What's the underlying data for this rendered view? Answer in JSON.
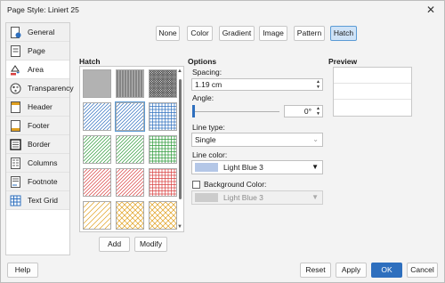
{
  "window": {
    "title": "Page Style: Liniert 25",
    "close_glyph": "✕"
  },
  "sidebar": {
    "items": [
      {
        "label": "General",
        "icon": "general-page-icon"
      },
      {
        "label": "Page",
        "icon": "page-icon"
      },
      {
        "label": "Area",
        "icon": "area-fill-icon",
        "active": true
      },
      {
        "label": "Transparency",
        "icon": "transparency-icon"
      },
      {
        "label": "Header",
        "icon": "header-icon"
      },
      {
        "label": "Footer",
        "icon": "footer-icon"
      },
      {
        "label": "Border",
        "icon": "border-icon"
      },
      {
        "label": "Columns",
        "icon": "columns-icon"
      },
      {
        "label": "Footnote",
        "icon": "footnote-icon"
      },
      {
        "label": "Text Grid",
        "icon": "text-grid-icon"
      }
    ]
  },
  "tabs": {
    "none": "None",
    "color": "Color",
    "gradient": "Gradient",
    "image": "Image",
    "pattern": "Pattern",
    "hatch": "Hatch",
    "active": "Hatch"
  },
  "hatch": {
    "title": "Hatch",
    "add_label": "Add",
    "modify_label": "Modify",
    "cells": [
      {
        "color": "#333333",
        "pattern": "horizontal-dense"
      },
      {
        "color": "#333333",
        "pattern": "cross-dense"
      },
      {
        "color": "#333333",
        "pattern": "cross-diag-dense"
      },
      {
        "color": "#2e6fbe",
        "pattern": "diagonal"
      },
      {
        "color": "#2e6fbe",
        "pattern": "diagonal-sel"
      },
      {
        "color": "#2e6fbe",
        "pattern": "cross"
      },
      {
        "color": "#2e9a3a",
        "pattern": "diagonal"
      },
      {
        "color": "#2e9a3a",
        "pattern": "diagonal"
      },
      {
        "color": "#2e9a3a",
        "pattern": "cross"
      },
      {
        "color": "#d94040",
        "pattern": "diagonal"
      },
      {
        "color": "#d94040",
        "pattern": "diagonal"
      },
      {
        "color": "#d94040",
        "pattern": "cross"
      },
      {
        "color": "#e0a020",
        "pattern": "diagonal-sparse"
      },
      {
        "color": "#e0a020",
        "pattern": "diamond"
      },
      {
        "color": "#e0a020",
        "pattern": "diamond"
      }
    ]
  },
  "options": {
    "title": "Options",
    "spacing_label": "Spacing:",
    "spacing_value": "1.19 cm",
    "angle_label": "Angle:",
    "angle_value": "0°",
    "line_type_label": "Line type:",
    "line_type_value": "Single",
    "line_color_label": "Line color:",
    "line_color_value": "Light Blue 3",
    "line_color_swatch": "#b4c7e7",
    "background_color_label": "Background Color:",
    "background_color_value": "Light Blue 3",
    "background_swatch": "#cccccc",
    "background_checked": false
  },
  "preview": {
    "title": "Preview"
  },
  "footer": {
    "help": "Help",
    "reset": "Reset",
    "apply": "Apply",
    "ok": "OK",
    "cancel": "Cancel"
  },
  "colors": {
    "accent": "#2e6fbe",
    "selected_tab_bg": "#cfe3f7"
  }
}
